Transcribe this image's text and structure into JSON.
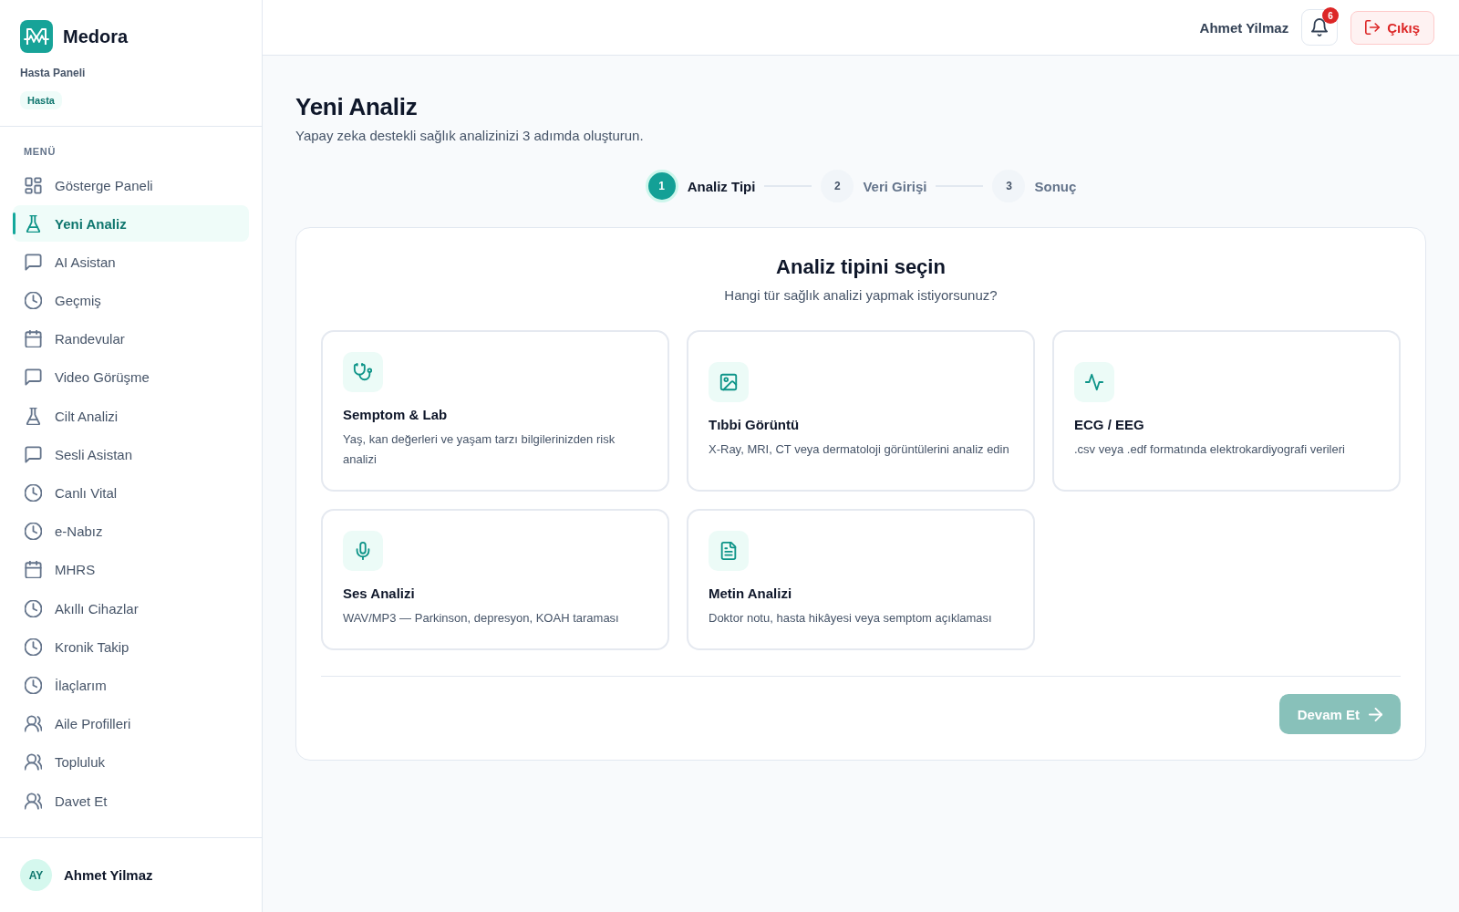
{
  "sidebar": {
    "brand": "Medora",
    "subtitle": "Hasta Paneli",
    "role_badge": "Hasta",
    "menu_label": "MENÜ",
    "items": [
      {
        "label": "Gösterge Paneli",
        "selected": false
      },
      {
        "label": "Yeni Analiz",
        "selected": true
      },
      {
        "label": "AI Asistan",
        "selected": false
      },
      {
        "label": "Geçmiş",
        "selected": false
      },
      {
        "label": "Randevular",
        "selected": false
      },
      {
        "label": "Video Görüşme",
        "selected": false
      },
      {
        "label": "Cilt Analizi",
        "selected": false
      },
      {
        "label": "Sesli Asistan",
        "selected": false
      },
      {
        "label": "Canlı Vital",
        "selected": false
      },
      {
        "label": "e-Nabız",
        "selected": false
      },
      {
        "label": "MHRS",
        "selected": false
      },
      {
        "label": "Akıllı Cihazlar",
        "selected": false
      },
      {
        "label": "Kronik Takip",
        "selected": false
      },
      {
        "label": "İlaçlarım",
        "selected": false
      },
      {
        "label": "Aile Profilleri",
        "selected": false
      },
      {
        "label": "Topluluk",
        "selected": false
      },
      {
        "label": "Davet Et",
        "selected": false
      }
    ],
    "user": {
      "initials": "AY",
      "name": "Ahmet Yilmaz"
    }
  },
  "header": {
    "user_name": "Ahmet Yilmaz",
    "notification_count": "6",
    "logout_button": "Çıkış"
  },
  "page": {
    "title": "Yeni Analiz",
    "subtitle": "Yapay zeka destekli sağlık analizinizi 3 adımda oluşturun."
  },
  "stepper": {
    "steps": [
      {
        "number": "1",
        "label": "Analiz Tipi",
        "current": true
      },
      {
        "number": "2",
        "label": "Veri Girişi",
        "current": false
      },
      {
        "number": "3",
        "label": "Sonuç",
        "current": false
      }
    ]
  },
  "panel": {
    "title": "Analiz tipini seçin",
    "subtitle": "Hangi tür sağlık analizi yapmak istiyorsunuz?",
    "options": [
      {
        "title": "Semptom & Lab",
        "description": "Yaş, kan değerleri ve yaşam tarzı bilgilerinizden risk analizi",
        "selected": false
      },
      {
        "title": "Tıbbi Görüntü",
        "description": "X-Ray, MRI, CT veya dermatoloji görüntülerini analiz edin",
        "selected": false
      },
      {
        "title": "ECG / EEG",
        "description": ".csv veya .edf formatında elektrokardiyografi verileri",
        "selected": false
      },
      {
        "title": "Ses Analizi",
        "description": "WAV/MP3 — Parkinson, depresyon, KOAH taraması",
        "selected": false
      },
      {
        "title": "Metin Analizi",
        "description": "Doktor notu, hasta hikâyesi veya semptom açıklaması",
        "selected": false
      }
    ],
    "continue_button": {
      "label": "Devam Et",
      "disabled": true
    }
  }
}
